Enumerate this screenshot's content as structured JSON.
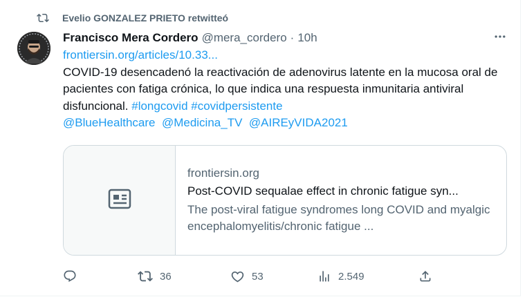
{
  "retweet": {
    "icon": "retweet-icon",
    "label": "Evelio GONZALEZ PRIETO retwitteó"
  },
  "tweet": {
    "author_name": "Francisco Mera Cordero",
    "handle": "@mera_cordero",
    "separator": "·",
    "time": "10h",
    "link_text": "frontiersin.org/articles/10.33...",
    "text_main": "COVID-19 desencadenó la reactivación de adenovirus  latente en la mucosa oral de pacientes con fatiga crónica, lo que indica una respuesta inmunitaria antiviral disfuncional.",
    "hashtags": [
      "#longcovid",
      "#covidpersistente"
    ],
    "mentions": [
      "@BlueHealthcare",
      "@Medicina_TV",
      "@AIREyVIDA2021"
    ]
  },
  "card": {
    "icon": "article-icon",
    "domain": "frontiersin.org",
    "title": "Post-COVID sequalae effect in chronic fatigue syn...",
    "description": "The post-viral fatigue syndromes long COVID and myalgic encephalomyelitis/chronic fatigue ..."
  },
  "actions": {
    "replies_icon": "reply-icon",
    "retweets_icon": "retweet-icon",
    "retweets": "36",
    "likes_icon": "heart-icon",
    "likes": "53",
    "views_icon": "views-icon",
    "views": "2.549",
    "share_icon": "share-icon"
  },
  "colors": {
    "link": "#1d9bf0",
    "secondary_text": "#536471",
    "primary_text": "#0f1419",
    "border": "#cfd9de"
  }
}
